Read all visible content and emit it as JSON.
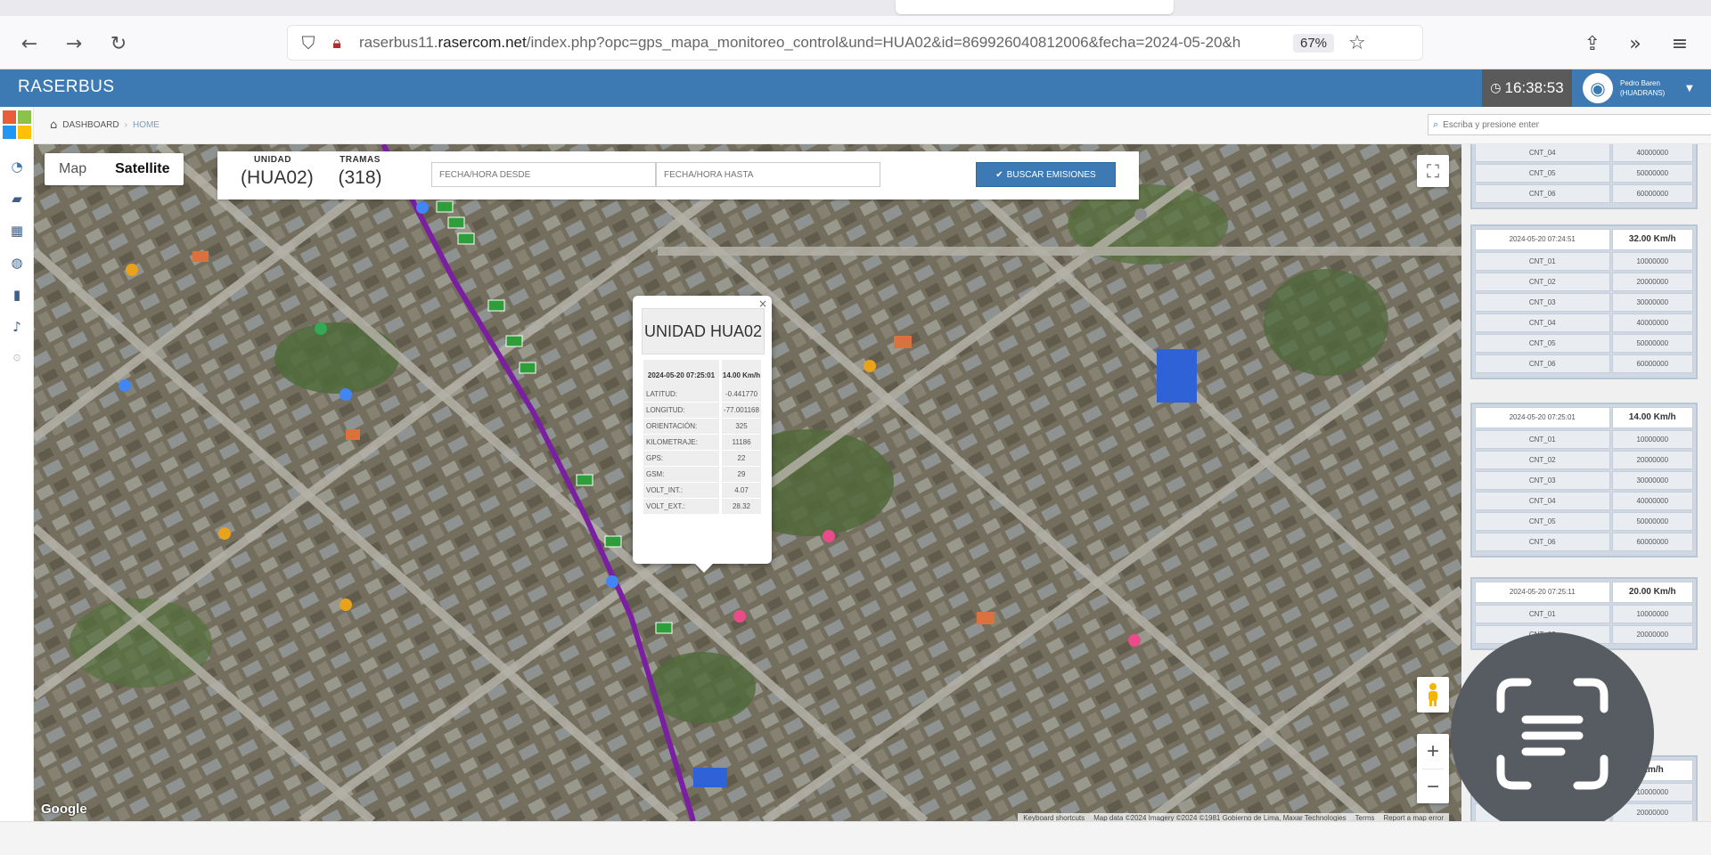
{
  "browser": {
    "url_prefix": "raserbus11.",
    "url_domain": "rasercom.net",
    "url_rest": "/index.php?opc=gps_mapa_monitoreo_control&und=HUA02&id=869926040812006&fecha=2024-05-20&h",
    "zoom": "67%",
    "icons": [
      "back-arrow",
      "forward-arrow",
      "reload",
      "shield",
      "lock",
      "star",
      "extensions",
      "overflow",
      "menu"
    ]
  },
  "header": {
    "brand": "RASERBUS",
    "clock": "16:38:53",
    "user_name": "Pedro Baren",
    "user_role": "(HUADRANS)"
  },
  "breadcrumb": {
    "dashboard": "DASHBOARD",
    "home": "HOME",
    "search_placeholder": "Escriba y presione enter"
  },
  "map": {
    "type_map": "Map",
    "type_satellite": "Satellite",
    "google": "Google",
    "attribution": [
      "Keyboard shortcuts",
      "Map data ©2024 Imagery ©2024 ©1981 Gobierno de Lima, Maxar Technologies",
      "Terms",
      "Report a map error"
    ],
    "zoom_in": "+",
    "zoom_out": "−"
  },
  "filter": {
    "unidad_label": "UNIDAD",
    "unidad_value": "(HUA02)",
    "tramas_label": "TRAMAS",
    "tramas_value": "(318)",
    "desde_placeholder": "FECHA/HORA DESDE",
    "hasta_placeholder": "FECHA/HORA HASTA",
    "button": "BUSCAR EMISIONES"
  },
  "info": {
    "title": "UNIDAD HUA02",
    "date": "2024-05-20 07:25:01",
    "speed": "14.00 Km/h",
    "rows": [
      {
        "k": "LATITUD:",
        "v": "-0.441770"
      },
      {
        "k": "LONGITUD:",
        "v": "-77.001168"
      },
      {
        "k": "ORIENTACIÓN:",
        "v": "325"
      },
      {
        "k": "KILOMETRAJE:",
        "v": "11186"
      },
      {
        "k": "GPS:",
        "v": "22"
      },
      {
        "k": "GSM:",
        "v": "29"
      },
      {
        "k": "VOLT_INT.:",
        "v": "4.07"
      },
      {
        "k": "VOLT_EXT.:",
        "v": "28.32"
      }
    ]
  },
  "emissions": {
    "group0": [
      {
        "k": "CNT_04",
        "v": "40000000"
      },
      {
        "k": "CNT_05",
        "v": "50000000"
      },
      {
        "k": "CNT_06",
        "v": "60000000"
      }
    ],
    "group1": {
      "date": "2024-05-20 07:24:51",
      "speed": "32.00 Km/h",
      "rows": [
        {
          "k": "CNT_01",
          "v": "10000000"
        },
        {
          "k": "CNT_02",
          "v": "20000000"
        },
        {
          "k": "CNT_03",
          "v": "30000000"
        },
        {
          "k": "CNT_04",
          "v": "40000000"
        },
        {
          "k": "CNT_05",
          "v": "50000000"
        },
        {
          "k": "CNT_06",
          "v": "60000000"
        }
      ]
    },
    "group2": {
      "date": "2024-05-20 07:25:01",
      "speed": "14.00 Km/h",
      "rows": [
        {
          "k": "CNT_01",
          "v": "10000000"
        },
        {
          "k": "CNT_02",
          "v": "20000000"
        },
        {
          "k": "CNT_03",
          "v": "30000000"
        },
        {
          "k": "CNT_04",
          "v": "40000000"
        },
        {
          "k": "CNT_05",
          "v": "50000000"
        },
        {
          "k": "CNT_06",
          "v": "60000000"
        }
      ]
    },
    "group3": {
      "date": "2024-05-20 07:25:11",
      "speed": "20.00 Km/h",
      "rows": [
        {
          "k": "CNT_01",
          "v": "10000000"
        },
        {
          "k": "CNT_02",
          "v": "20000000"
        }
      ]
    },
    "group4": {
      "speed": "Km/h",
      "rows": [
        {
          "k": "CNT_01",
          "v": "10000000"
        },
        {
          "k": "CNT_02",
          "v": "20000000"
        }
      ]
    }
  },
  "colors": {
    "header_blue": "#3d7ab4",
    "route_purple": "#7b1fa2",
    "marker_green": "#2e9e3a"
  }
}
